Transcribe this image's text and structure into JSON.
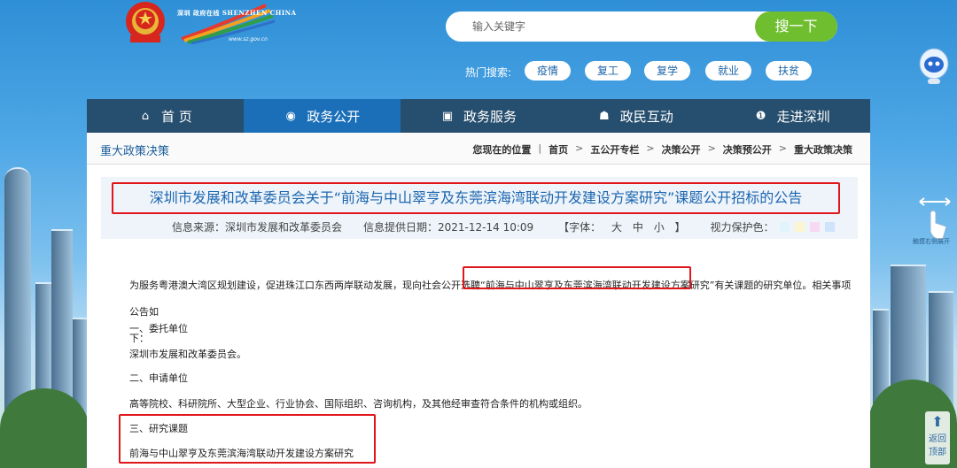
{
  "header": {
    "logo_text": "深圳 政府在线 SHENZHEN CHINA",
    "logo_site": "www.sz.gov.cn",
    "search": {
      "placeholder": "输入关键字",
      "button": "搜一下"
    },
    "hot_label": "热门搜索:",
    "hot_tags": [
      "疫情",
      "复工",
      "复学",
      "就业",
      "扶贫"
    ]
  },
  "nav": [
    {
      "label": "首 页",
      "icon": "home-icon",
      "glyph": "⌂"
    },
    {
      "label": "政务公开",
      "icon": "eye-icon",
      "glyph": "◉"
    },
    {
      "label": "政务服务",
      "icon": "monitor-icon",
      "glyph": "▣"
    },
    {
      "label": "政民互动",
      "icon": "people-icon",
      "glyph": "☗"
    },
    {
      "label": "走进深圳",
      "icon": "info-icon",
      "glyph": "❶"
    }
  ],
  "section_title": "重大政策决策",
  "breadcrumb": {
    "label": "您现在的位置",
    "items": [
      "首页",
      "五公开专栏",
      "决策公开",
      "决策预公开",
      "重大政策决策"
    ]
  },
  "article": {
    "title": "深圳市发展和改革委员会关于“前海与中山翠亨及东莞滨海湾联动开发建设方案研究”课题公开招标的公告",
    "source": "信息来源：深圳市发展和改革委员会",
    "date": "信息提供日期：2021-12-14 10:09",
    "font_label": "【字体：",
    "font_sizes": [
      "大",
      "中",
      "小"
    ],
    "font_close": "】",
    "vision_label": "视力保护色：",
    "vision_colors": [
      "#dff4fb",
      "#fbf6cf",
      "#f7d9f3",
      "#cfe3fb"
    ],
    "p1_before": "为服务粤港澳大湾区规划建设，促进珠江口东西两岸联动发展，现向社会公开选聘",
    "p1_highlight": "“前海与中山翠亨及东莞滨海湾联动开发建设方案研究”",
    "p1_after": "有关课题的研究单位。相关事项公告如",
    "p1_cont": "下：",
    "s1_title": "一、委托单位",
    "s1_body": "深圳市发展和改革委员会。",
    "s2_title": "二、申请单位",
    "s2_body": "高等院校、科研院所、大型企业、行业协会、国际组织、咨询机构，及其他经审查符合条件的机构或组织。",
    "s3_title": "三、研究课题",
    "s3_body": "前海与中山翠亨及东莞滨海湾联动开发建设方案研究"
  },
  "side": {
    "hint": "触摸右侧展开",
    "back_top": "返回顶部"
  }
}
